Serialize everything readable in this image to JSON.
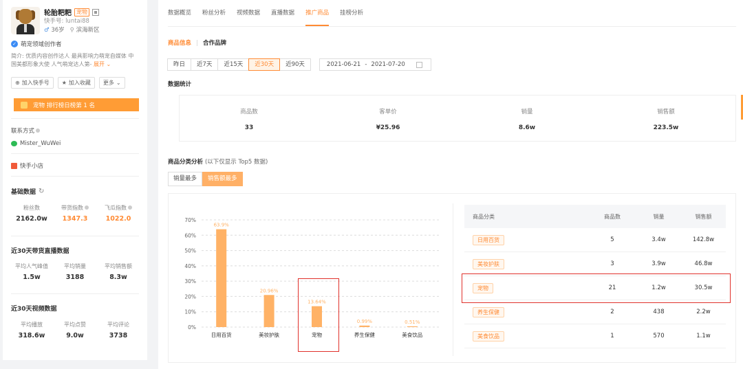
{
  "profile": {
    "name": "轮胎粑粑",
    "category_tag": "宠物",
    "ks_id": "快手号: luntai88",
    "age": "36岁",
    "location": "滨海新区",
    "certification": "萌宠领域创作者",
    "intro": "简介: 优质内容创作达人 最具影响力萌宠自媒体 中国美都形象大使 人气萌宠达人第-",
    "expand_label": "展开",
    "buttons": [
      "加入快手号",
      "加入收藏",
      "更多"
    ],
    "rank_banner": "宠物 排行榜日榜第 1 名",
    "contact_label": "联系方式",
    "wechat": "Mister_WuWei",
    "store_label": "快手小店"
  },
  "basic_data": {
    "title": "基础数据",
    "stats": [
      {
        "label": "粉丝数",
        "value": "2162.0w"
      },
      {
        "label": "带货指数",
        "value": "1347.3"
      },
      {
        "label": "飞瓜指数",
        "value": "1022.0"
      }
    ]
  },
  "live_30": {
    "title": "近30天带货直播数据",
    "stats": [
      {
        "label": "平均人气峰值",
        "value": "1.5w"
      },
      {
        "label": "平均销量",
        "value": "3188"
      },
      {
        "label": "平均销售额",
        "value": "8.3w"
      }
    ]
  },
  "video_30": {
    "title": "近30天视频数据",
    "stats": [
      {
        "label": "平均播放",
        "value": "318.6w"
      },
      {
        "label": "平均点赞",
        "value": "9.0w"
      },
      {
        "label": "平均评论",
        "value": "3738"
      }
    ]
  },
  "tabs": [
    "数据概览",
    "粉丝分析",
    "视频数据",
    "直播数据",
    "推广商品",
    "挂榜分析"
  ],
  "active_tab_index": 4,
  "subtabs": [
    "商品信息",
    "合作品牌"
  ],
  "ranges": [
    "昨日",
    "近7天",
    "近15天",
    "近30天",
    "近90天"
  ],
  "active_range_index": 3,
  "date_start": "2021-06-21",
  "date_sep": "-",
  "date_end": "2021-07-20",
  "stats_title": "数据统计",
  "summary": [
    {
      "label": "商品数",
      "value": "33"
    },
    {
      "label": "客单价",
      "value": "¥25.96"
    },
    {
      "label": "销量",
      "value": "8.6w"
    },
    {
      "label": "销售额",
      "value": "223.5w"
    }
  ],
  "category_analysis": {
    "title": "商品分类分析",
    "note": "(以下仅显示 Top5 数据)",
    "toggles": [
      "销量最多",
      "销售额最多"
    ],
    "active_toggle_index": 1
  },
  "chart_data": {
    "type": "bar",
    "categories": [
      "日用百货",
      "美妆护肤",
      "宠物",
      "养生保健",
      "美食饮品"
    ],
    "values": [
      63.9,
      20.96,
      13.64,
      0.99,
      0.51
    ],
    "value_labels": [
      "63.9%",
      "20.96%",
      "13.64%",
      "0.99%",
      "0.51%"
    ],
    "ylim": [
      0,
      70
    ],
    "yticks": [
      "0%",
      "10%",
      "20%",
      "30%",
      "40%",
      "50%",
      "60%",
      "70%"
    ],
    "grid": true,
    "bar_color": "#ffb266",
    "label_color": "#ffb266",
    "highlighted_category": "宠物"
  },
  "table": {
    "headers": [
      "商品分类",
      "商品数",
      "销量",
      "销售额"
    ],
    "rows": [
      {
        "category": "日用百货",
        "count": "5",
        "sales": "3.4w",
        "revenue": "142.8w"
      },
      {
        "category": "美妆护肤",
        "count": "3",
        "sales": "3.9w",
        "revenue": "46.8w"
      },
      {
        "category": "宠物",
        "count": "21",
        "sales": "1.2w",
        "revenue": "30.5w"
      },
      {
        "category": "养生保健",
        "count": "2",
        "sales": "438",
        "revenue": "2.2w"
      },
      {
        "category": "美食饮品",
        "count": "1",
        "sales": "570",
        "revenue": "1.1w"
      }
    ]
  },
  "colors": {
    "accent": "#ff8a33",
    "highlight_box": "#e0302a"
  }
}
